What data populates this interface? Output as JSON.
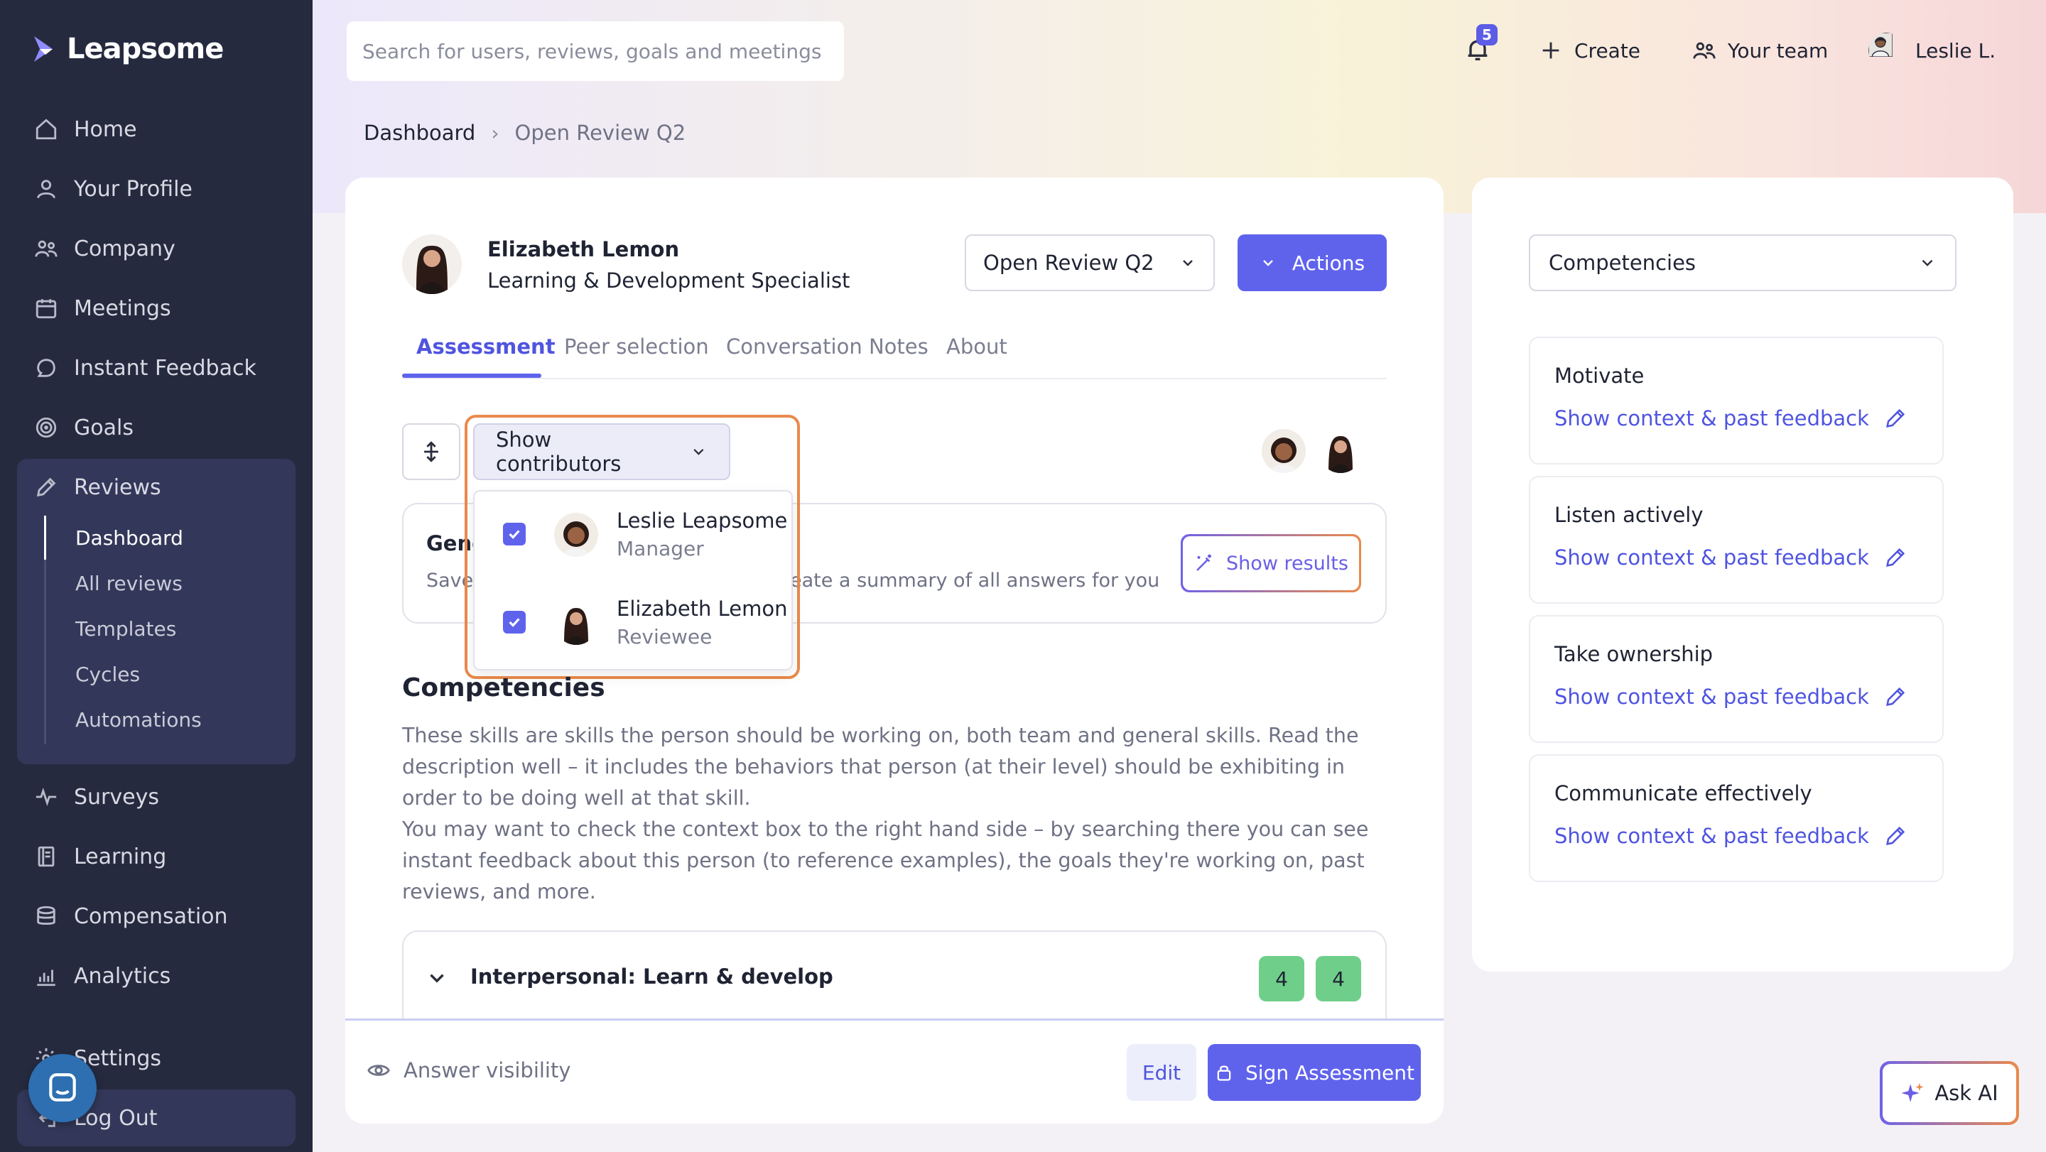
{
  "brand": {
    "name": "Leapsome"
  },
  "sidebar": {
    "items": [
      {
        "label": "Home",
        "icon": "home-icon"
      },
      {
        "label": "Your Profile",
        "icon": "user-icon"
      },
      {
        "label": "Company",
        "icon": "company-icon"
      },
      {
        "label": "Meetings",
        "icon": "calendar-icon"
      },
      {
        "label": "Instant Feedback",
        "icon": "chat-icon"
      },
      {
        "label": "Goals",
        "icon": "target-icon"
      },
      {
        "label": "Reviews",
        "icon": "pencil-icon"
      },
      {
        "label": "Surveys",
        "icon": "pulse-icon"
      },
      {
        "label": "Learning",
        "icon": "book-icon"
      },
      {
        "label": "Compensation",
        "icon": "coins-icon"
      },
      {
        "label": "Analytics",
        "icon": "chart-icon"
      },
      {
        "label": "Settings",
        "icon": "gear-icon"
      },
      {
        "label": "Log Out",
        "icon": "logout-icon"
      }
    ],
    "reviews_sub": [
      {
        "label": "Dashboard",
        "active": true
      },
      {
        "label": "All reviews"
      },
      {
        "label": "Templates"
      },
      {
        "label": "Cycles"
      },
      {
        "label": "Automations"
      }
    ]
  },
  "header": {
    "search_placeholder": "Search for users, reviews, goals and meetings",
    "notification_count": "5",
    "create_label": "Create",
    "team_label": "Your team",
    "user_label": "Leslie L."
  },
  "breadcrumb": {
    "home": "Dashboard",
    "separator": "›",
    "current": "Open Review Q2"
  },
  "review": {
    "person_name": "Elizabeth Lemon",
    "person_role": "Learning & Development Specialist",
    "cycle": "Open Review Q2",
    "actions_label": "Actions",
    "tabs": [
      "Assessment",
      "Peer selection",
      "Conversation Notes",
      "About"
    ]
  },
  "contributors": {
    "button_label": "Show contributors",
    "items": [
      {
        "name": "Leslie Leapsome",
        "role": "Manager",
        "checked": true
      },
      {
        "name": "Elizabeth Lemon",
        "role": "Reviewee",
        "checked": true
      }
    ]
  },
  "general": {
    "title_visible": "Gene",
    "desc_left": "Save",
    "desc_right": "eate a summary of all answers for you",
    "show_results_label": "Show results"
  },
  "competencies": {
    "title": "Competencies",
    "desc_1": "These skills are skills the person should be working on, both team and general skills. Read the description well – it includes the behaviors that person (at their level) should be exhibiting in order to be doing well at that skill.",
    "desc_2": "You may want to check the context box to the right hand side – by searching there you can see instant feedback about this person (to reference examples), the goals they're working on, past reviews, and more.",
    "section_title": "Interpersonal: Learn & develop",
    "scores": [
      "4",
      "4"
    ]
  },
  "footer": {
    "answer_visibility": "Answer visibility",
    "edit_label": "Edit",
    "sign_label": "Sign Assessment"
  },
  "context_panel": {
    "select_label": "Competencies",
    "link_label": "Show context & past feedback",
    "cards": [
      "Motivate",
      "Listen actively",
      "Take ownership",
      "Communicate effectively"
    ]
  },
  "ask_ai_label": "Ask AI",
  "colors": {
    "accent": "#5f63ec",
    "sidebar": "#262a3f",
    "highlight": "#ea8a4c",
    "score": "#6fcf8a"
  }
}
